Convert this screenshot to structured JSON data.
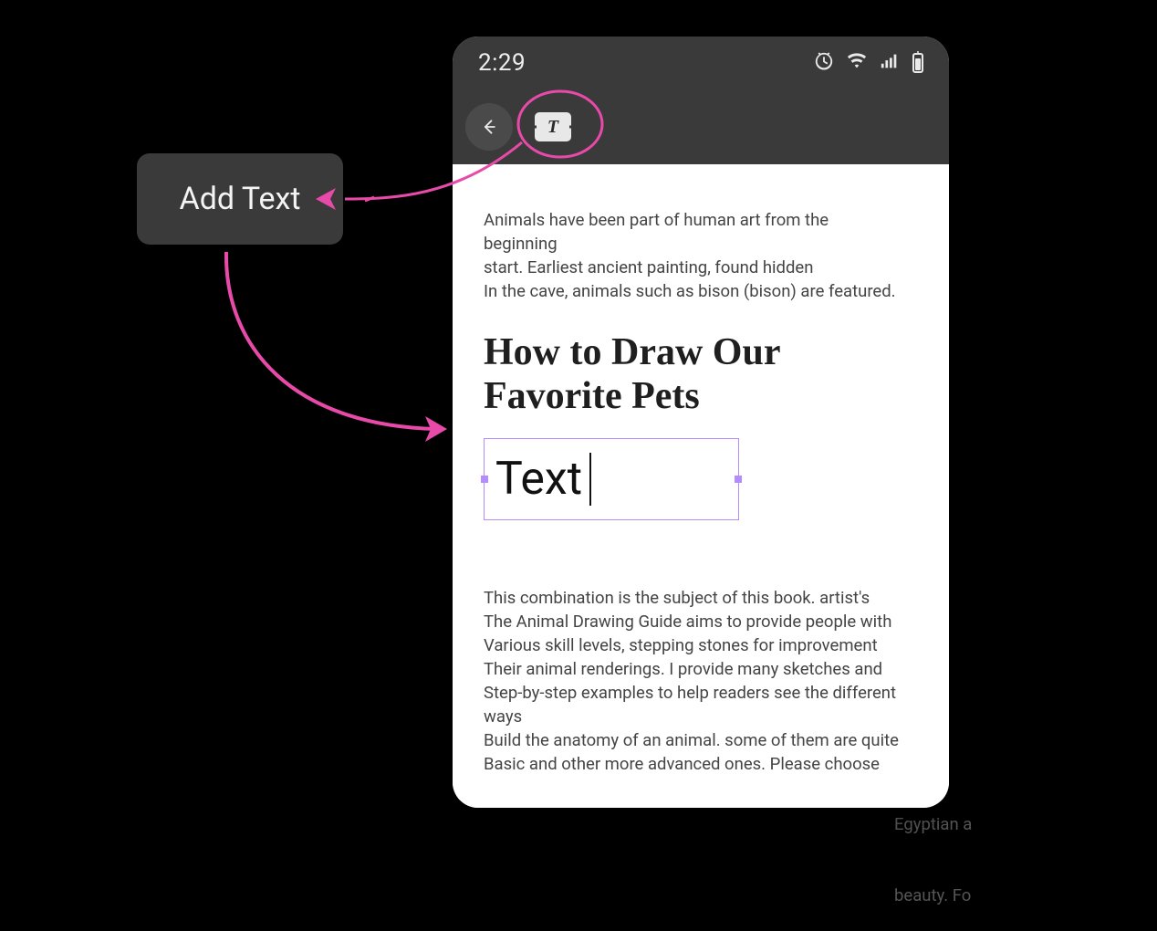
{
  "tooltip": {
    "label": "Add Text"
  },
  "statusbar": {
    "time": "2:29"
  },
  "toolbar": {
    "text_icon_letter": "T"
  },
  "page": {
    "intro_line1": "Animals have been part of human art from the beginning",
    "intro_line2": "start. Earliest ancient painting, found hidden",
    "intro_line3": "In the cave, animals such as bison (bison) are featured.",
    "heading": "How to Draw Our Favorite Pets",
    "text_box_value": "Text",
    "body_line1": "This combination is the subject of this book. artist's",
    "body_line2": "The Animal Drawing Guide aims to provide people with",
    "body_line3": "Various skill levels, stepping stones for improvement",
    "body_line4": "Their animal renderings. I provide many sketches and",
    "body_line5": "Step-by-step examples to help readers see the different ways",
    "body_line6": "Build the anatomy of an animal. some of them are quite",
    "body_line7": "Basic and other more advanced ones. Please choose"
  },
  "side": {
    "line1": "Egyptian a",
    "line2": "beauty. Fo"
  },
  "annotation_color": "#e84aa9"
}
